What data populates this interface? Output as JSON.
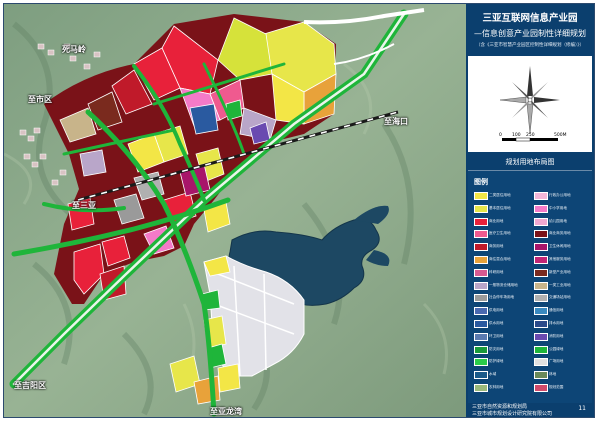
{
  "panel": {
    "title": "三亚互联网信息产业园",
    "subtitle": "—信息创意产业园制性详细规划",
    "note": "（含《三亚市智慧产业园区控制性详细规划（修编）》）",
    "scale_labels": [
      "0",
      "100",
      "250",
      "500M"
    ],
    "map_title": "规划用地布局图",
    "legend_heading": "图例",
    "legend": [
      {
        "label": "二类居住用地",
        "color": "#f3e646"
      },
      {
        "label": "行政办公用地",
        "color": "#f2b6d8"
      },
      {
        "label": "基本居住用地",
        "color": "#e7e64a"
      },
      {
        "label": "中小学用地",
        "color": "#f47ac8"
      },
      {
        "label": "商业用地",
        "color": "#e8213a"
      },
      {
        "label": "幼儿园用地",
        "color": "#f0a8d0"
      },
      {
        "label": "医疗卫生用地",
        "color": "#ef5a8f"
      },
      {
        "label": "商业商务用地",
        "color": "#7a1218"
      },
      {
        "label": "商务用地",
        "color": "#c01a2a"
      },
      {
        "label": "卫生休闲用地",
        "color": "#a8156a"
      },
      {
        "label": "商住混合用地",
        "color": "#e8a23a"
      },
      {
        "label": "其他服务用地",
        "color": "#c32676"
      },
      {
        "label": "科研用地",
        "color": "#d85a90"
      },
      {
        "label": "新型产业用地",
        "color": "#7a2a1e"
      },
      {
        "label": "一般物流仓储用地",
        "color": "#b9a6c9"
      },
      {
        "label": "一类工业用地",
        "color": "#c8b48a"
      },
      {
        "label": "社会停车场用地",
        "color": "#9a9a9a"
      },
      {
        "label": "交通场站用地",
        "color": "#b0b0b0"
      },
      {
        "label": "供电用地",
        "color": "#4a6ab0"
      },
      {
        "label": "通信用地",
        "color": "#3a8ac0"
      },
      {
        "label": "供水用地",
        "color": "#2a5aa0"
      },
      {
        "label": "排水用地",
        "color": "#2a4a8a"
      },
      {
        "label": "环卫用地",
        "color": "#5a7ab0"
      },
      {
        "label": "消防用地",
        "color": "#6a4ab0"
      },
      {
        "label": "防灾用地",
        "color": "#1a9a3a"
      },
      {
        "label": "公园绿地",
        "color": "#1fb53a"
      },
      {
        "label": "防护绿地",
        "color": "#2acc4a"
      },
      {
        "label": "广场用地",
        "color": "#e0e0e0"
      },
      {
        "label": "水域",
        "color": "#1a5a8a"
      },
      {
        "label": "林地",
        "color": "#6a8a5a"
      },
      {
        "label": "农林用地",
        "color": "#9ab87a"
      },
      {
        "label": "规划范围",
        "color": "#d04a6a"
      }
    ],
    "footer": [
      "三亚市自然资源和规划局",
      "三亚市城市规划设计研究院有限公司"
    ],
    "page_number": "11"
  },
  "map": {
    "labels": {
      "siwaling": "死马岭",
      "to_city": "至市区",
      "to_haikou": "至海口",
      "to_sanya": "至三亚",
      "to_jiyang": "至吉阳区",
      "to_yalonghu": "至亚龙湾"
    }
  },
  "colors": {
    "panel_bg": "#0b3f6e",
    "water": "#1d4863",
    "terrain": "#8aa88c",
    "road": "#1fb53a"
  }
}
